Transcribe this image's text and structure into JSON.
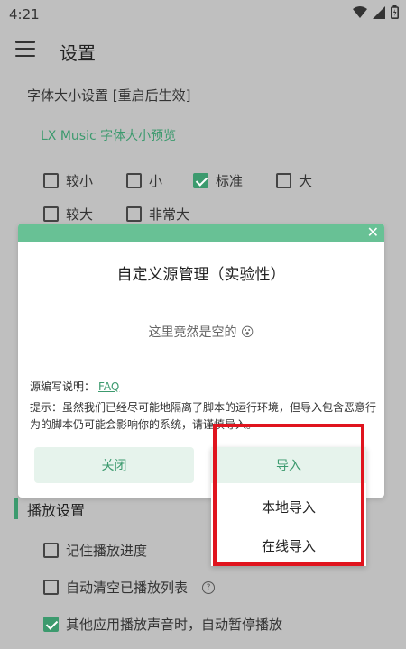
{
  "status_bar": {
    "time": "4:21",
    "icons": [
      "wifi-icon",
      "signal-icon",
      "battery-icon"
    ]
  },
  "header": {
    "title": "设置",
    "menu_icon": "menu-icon"
  },
  "font_size_section": {
    "label": "字体大小设置 [重启后生效]",
    "preview": "LX Music 字体大小预览",
    "options": [
      {
        "label": "较小",
        "checked": false
      },
      {
        "label": "小",
        "checked": false
      },
      {
        "label": "标准",
        "checked": true
      },
      {
        "label": "大",
        "checked": false
      },
      {
        "label": "较大",
        "checked": false
      },
      {
        "label": "非常大",
        "checked": false
      }
    ]
  },
  "dialog": {
    "title": "自定义源管理（实验性）",
    "empty_text": "这里竟然是空的 😮",
    "doc_label": "源编写说明：",
    "doc_link": "FAQ",
    "warning": "提示：虽然我们已经尽可能地隔离了脚本的运行环境，但导入包含恶意行为的脚本仍可能会影响你的系统，请谨慎导入。",
    "close_button": "关闭",
    "import_button": "导入"
  },
  "dropdown": {
    "items": [
      "本地导入",
      "在线导入"
    ]
  },
  "play_settings": {
    "title": "播放设置",
    "options": [
      {
        "label": "记住播放进度",
        "checked": false
      },
      {
        "label": "自动清空已播放列表",
        "checked": false,
        "help": "?"
      },
      {
        "label": "其他应用播放声音时，自动暂停播放",
        "checked": true
      }
    ]
  },
  "colors": {
    "accent": "#3c9a6e",
    "dialog_header": "#68c195",
    "highlight_box": "#e0141e",
    "overlay": "#bfbfbf"
  }
}
